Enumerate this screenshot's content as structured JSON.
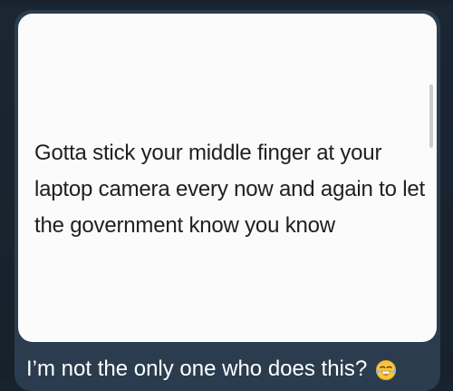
{
  "chat": {
    "image_text": "Gotta stick your middle finger at your laptop camera every now and again to let the government know you know",
    "caption": "I’m not the only one who does this?",
    "caption_icon": "laughing-with-tears-icon",
    "colors": {
      "background": "#18232f",
      "bubble": "#2b3c4e",
      "image_bg": "#fbfbfb",
      "caption_text": "#ffffff",
      "meme_text": "#202020"
    }
  }
}
